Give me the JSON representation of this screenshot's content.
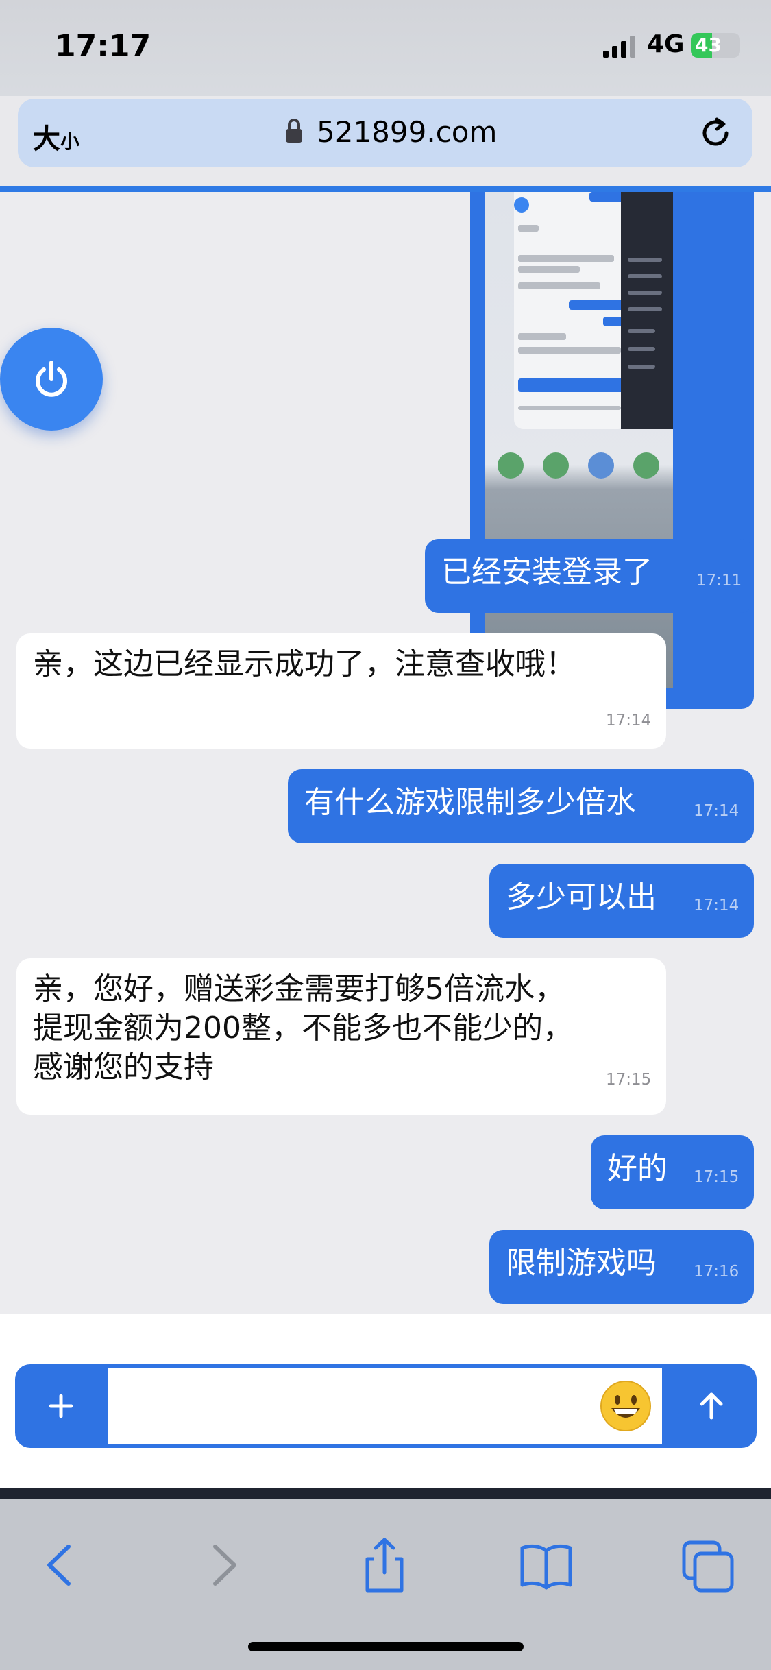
{
  "status_bar": {
    "time": "17:17",
    "network": "4G",
    "battery": "43",
    "battery_level": 0.43,
    "battery_color": "#34c759"
  },
  "browser": {
    "text_size_large": "大",
    "text_size_small": "小",
    "url": "521899.com"
  },
  "colors": {
    "accent": "#2f73e3",
    "incoming_bg": "#ffffff",
    "chat_bg": "#ececef"
  },
  "chat": {
    "messages": [
      {
        "side": "out",
        "text": "已经安装登录了",
        "time": "17:11"
      },
      {
        "side": "in",
        "text": "亲，这边已经显示成功了，注意查收哦！",
        "time": "17:14"
      },
      {
        "side": "out",
        "text": "有什么游戏限制多少倍水",
        "time": "17:14"
      },
      {
        "side": "out",
        "text": "多少可以出",
        "time": "17:14"
      },
      {
        "side": "in",
        "lines": [
          "亲，您好，赠送彩金需要打够5倍流水，",
          "提现金额为200整，不能多也不能少的，",
          "感谢您的支持"
        ],
        "time": "17:15"
      },
      {
        "side": "out",
        "text": "好的",
        "time": "17:15"
      },
      {
        "side": "out",
        "text": "限制游戏吗",
        "time": "17:16"
      }
    ]
  },
  "composer": {
    "placeholder": "",
    "value": "",
    "plus_icon": "plus-icon",
    "emoji": "😀",
    "send_icon": "arrow-up-icon"
  },
  "toolbar": {
    "icons": [
      "back-icon",
      "forward-icon",
      "share-icon",
      "bookmarks-icon",
      "tabs-icon"
    ]
  }
}
